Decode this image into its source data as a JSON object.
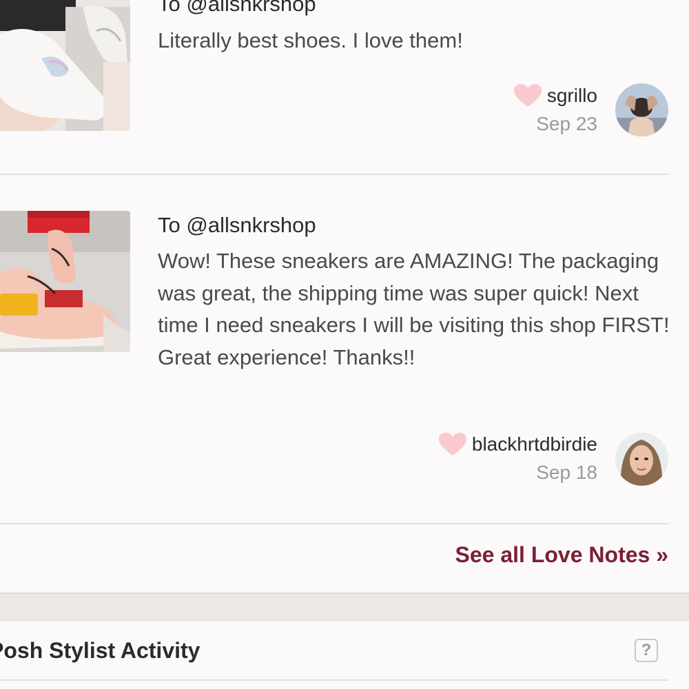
{
  "love_notes": [
    {
      "to": "To @allsnkrshop",
      "body": "Literally best shoes. I love them!",
      "author": "sgrillo",
      "date": "Sep 23",
      "heart_color": "#f9c9cf",
      "thumb_icon": "white-sneakers-photo",
      "avatar_icon": "user-avatar"
    },
    {
      "to": "To @allsnkrshop",
      "body": "Wow! These sneakers are AMAZING! The packaging was great, the shipping time was super quick! Next time I need sneakers I will be visiting this shop FIRST! Great experience! Thanks!!",
      "author": "blackhrtdbirdie",
      "date": "Sep 18",
      "heart_color": "#f9c9cf",
      "thumb_icon": "peach-sneakers-photo",
      "avatar_icon": "user-avatar"
    }
  ],
  "see_all": "See all Love Notes »",
  "stylist": {
    "title": "Posh Stylist Activity",
    "help_label": "?"
  },
  "colors": {
    "accent": "#7b2035",
    "background": "#fbf9f9",
    "band": "#ece9e4"
  }
}
